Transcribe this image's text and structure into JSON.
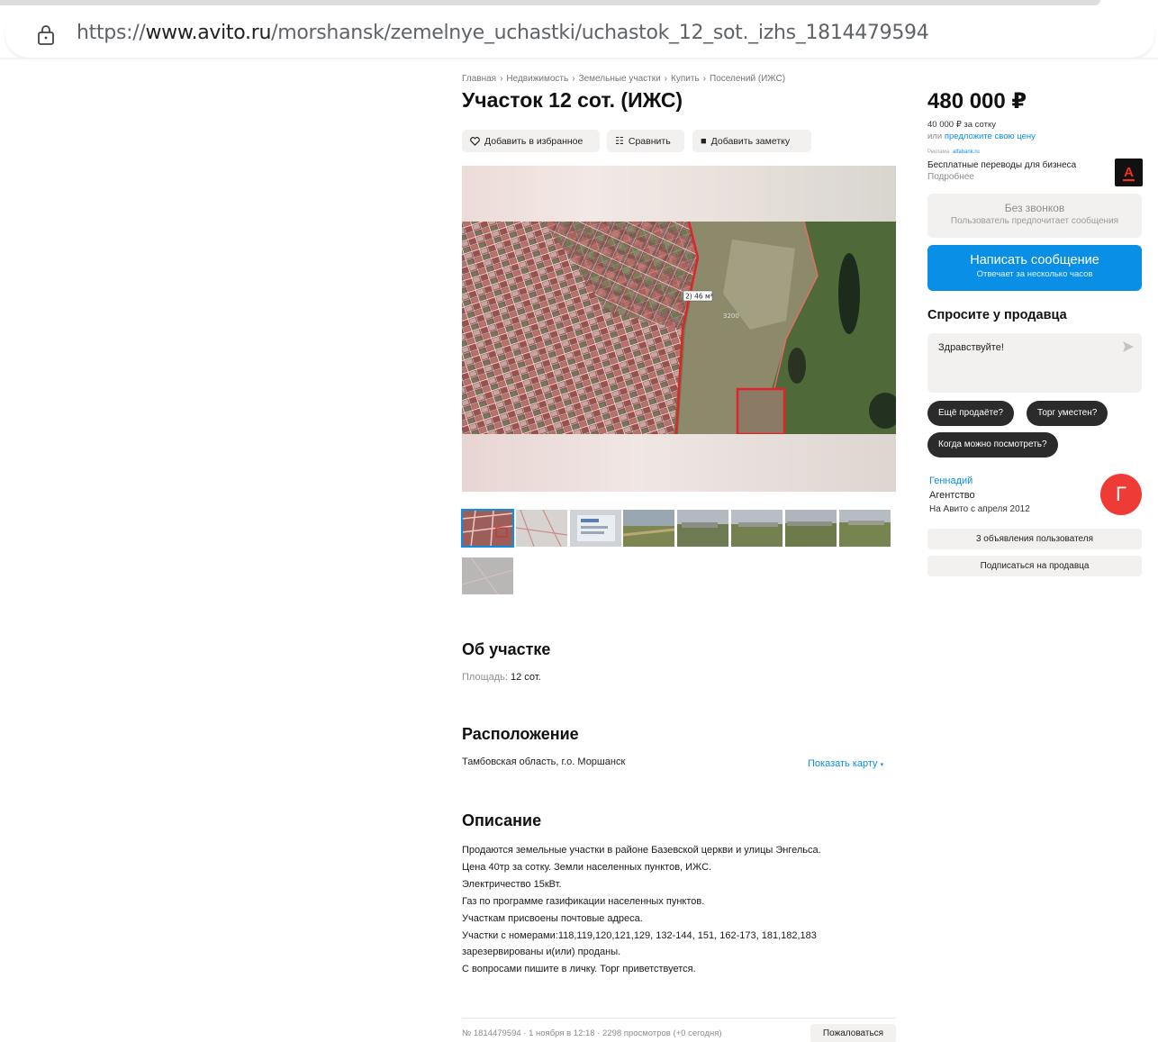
{
  "browser": {
    "url_prefix": "https://",
    "url_domain": "www.avito.ru",
    "url_path": "/morshansk/zemelnye_uchastki/uchastok_12_sot._izhs_1814479594"
  },
  "breadcrumbs": [
    "Главная",
    "Недвижимость",
    "Земельные участки",
    "Купить",
    "Поселений (ИЖС)"
  ],
  "breadcrumb_separator": "›",
  "listing": {
    "title": "Участок 12 сот. (ИЖС)",
    "actions": {
      "favorite": "Добавить в избранное",
      "compare": "Сравнить",
      "note": "Добавить заметку"
    },
    "map_labels": [
      "2) 46 м²",
      "3200"
    ],
    "thumbnail_count": 9
  },
  "about": {
    "heading": "Об участке",
    "area_label": "Площадь:",
    "area_value": "12 сот."
  },
  "location": {
    "heading": "Расположение",
    "address": "Тамбовская область, г.о. Моршанск",
    "show_map": "Показать карту"
  },
  "description": {
    "heading": "Описание",
    "lines": [
      "Продаются земельные участки в районе Базевской церкви и улицы Энгельса.",
      "Цена 40тр за сотку. Земли населенных пунктов, ИЖС.",
      "Электричество 15кВт.",
      "Газ по программе газификации населенных пунктов.",
      "Участкам присвоены почтовые адреса.",
      "Участки с номерами:118,119,120,121,129, 132-144, 151, 162-173, 181,182,183",
      "зарезервированы и(или) проданы.",
      "С вопросами пишите в личку. Торг приветствуется."
    ]
  },
  "footer": {
    "meta": "№ 1814479594 · 1 ноября в 12:18 · 2298 просмотров (+0 сегодня)",
    "complain": "Пожаловаться"
  },
  "sidebar": {
    "price": "480 000 ₽",
    "price_per_unit": "40 000 ₽ за сотку",
    "offer_prefix": "или",
    "offer_link": "предложите свою цену",
    "ad_label": "Реклама",
    "ad_source": "alfabank.ru",
    "ad_text": "Бесплатные переводы для бизнеса",
    "ad_more": "Подробнее",
    "ad_logo_letter": "А",
    "no_calls_title": "Без звонков",
    "no_calls_subtitle": "Пользователь предпочитает сообщения",
    "write_title": "Написать сообщение",
    "write_subtitle": "Отвечает за несколько часов",
    "ask_heading": "Спросите у продавца",
    "message_text": "Здравствуйте!",
    "chips": [
      "Ещё продаёте?",
      "Торг уместен?",
      "Когда можно посмотреть?"
    ],
    "seller_name": "Геннадий",
    "seller_type": "Агентство",
    "seller_since": "На Авито с апреля 2012",
    "avatar_letter": "Г",
    "user_ads": "3 объявления пользователя",
    "subscribe": "Подписаться на продавца"
  },
  "colors": {
    "accent": "#0a8fe6",
    "avatar": "#ef3b36",
    "chip": "#2b2b2b",
    "button_grey": "#f2f1f0"
  }
}
